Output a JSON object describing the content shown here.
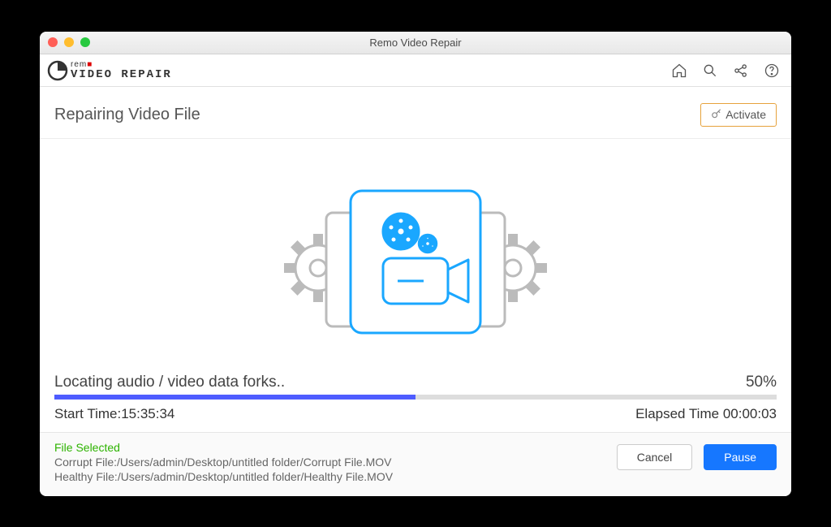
{
  "window": {
    "title": "Remo Video Repair"
  },
  "header": {
    "brand_text": "rem",
    "app_text": "VIDEO REPAIR"
  },
  "subheader": {
    "page_title": "Repairing Video File",
    "activate_label": "Activate"
  },
  "progress": {
    "status_text": "Locating audio / video data forks..",
    "percent_text": "50%",
    "percent_value": 50,
    "start_time_label": "Start Time:",
    "start_time_value": "15:35:34",
    "elapsed_label": "Elapsed Time ",
    "elapsed_value": "00:00:03"
  },
  "footer": {
    "file_selected_label": "File Selected",
    "corrupt_label": "Corrupt File:",
    "corrupt_path": "/Users/admin/Desktop/untitled folder/Corrupt File.MOV",
    "healthy_label": "Healthy File:",
    "healthy_path": "/Users/admin/Desktop/untitled folder/Healthy File.MOV",
    "cancel_label": "Cancel",
    "pause_label": "Pause"
  }
}
